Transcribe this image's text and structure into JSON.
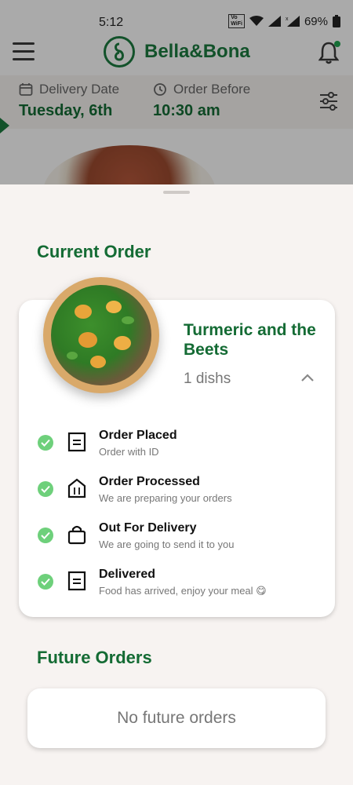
{
  "status_bar": {
    "time": "5:12",
    "vowifi_top": "Vo",
    "vowifi_bottom": "WiFi",
    "battery": "69%"
  },
  "header": {
    "brand": "Bella&Bona",
    "icons": [
      "menu-icon",
      "logo-icon",
      "bell-icon"
    ]
  },
  "delivery_info": {
    "date_label": "Delivery Date",
    "date_value": "Tuesday, 6th",
    "time_label": "Order Before",
    "time_value": "10:30 am"
  },
  "current_order": {
    "title": "Current Order",
    "dish_name": "Turmeric and the Beets",
    "dish_count": "1 dishs",
    "steps": [
      {
        "title": "Order Placed",
        "subtitle": "Order with ID",
        "icon": "document-icon"
      },
      {
        "title": "Order Processed",
        "subtitle": "We are preparing your orders",
        "icon": "kitchen-icon"
      },
      {
        "title": "Out For Delivery",
        "subtitle": "We are going to send it to you",
        "icon": "bag-icon"
      },
      {
        "title": "Delivered",
        "subtitle": "Food has arrived, enjoy your meal 😋",
        "icon": "document-icon"
      }
    ]
  },
  "future_orders": {
    "title": "Future Orders",
    "empty_text": "No future orders"
  },
  "colors": {
    "brand_green": "#146b34",
    "check_green": "#6ed07b",
    "background": "#f7f3f1"
  }
}
